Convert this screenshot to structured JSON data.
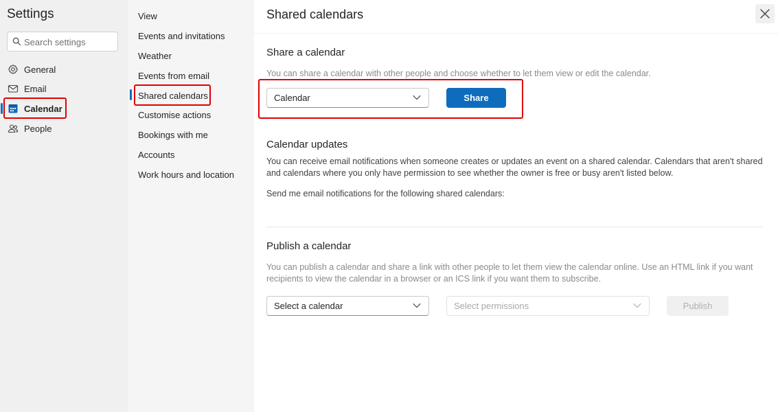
{
  "settings": {
    "title": "Settings",
    "search_placeholder": "Search settings",
    "nav": [
      {
        "label": "General",
        "icon": "gear-icon"
      },
      {
        "label": "Email",
        "icon": "mail-icon"
      },
      {
        "label": "Calendar",
        "icon": "calendar-icon",
        "active": true
      },
      {
        "label": "People",
        "icon": "people-icon"
      }
    ]
  },
  "calendar_menu": {
    "items": [
      "View",
      "Events and invitations",
      "Weather",
      "Events from email",
      "Shared calendars",
      "Customise actions",
      "Bookings with me",
      "Accounts",
      "Work hours and location"
    ],
    "active": "Shared calendars"
  },
  "main": {
    "title": "Shared calendars",
    "close_icon": "close-icon",
    "share": {
      "title": "Share a calendar",
      "description": "You can share a calendar with other people and choose whether to let them view or edit the calendar.",
      "calendar_value": "Calendar",
      "share_label": "Share"
    },
    "updates": {
      "title": "Calendar updates",
      "description": "You can receive email notifications when someone creates or updates an event on a shared calendar. Calendars that aren't shared and calendars where you only have permission to see whether the owner is free or busy aren't listed below.",
      "notify_label": "Send me email notifications for the following shared calendars:"
    },
    "publish": {
      "title": "Publish a calendar",
      "description": "You can publish a calendar and share a link with other people to let them view the calendar online. Use an HTML link if you want recipients to view the calendar in a browser or an ICS link if you want them to subscribe.",
      "calendar_placeholder": "Select a calendar",
      "permissions_placeholder": "Select permissions",
      "publish_label": "Publish"
    }
  },
  "colors": {
    "accent": "#0f6cbd",
    "highlight": "#e00000"
  }
}
